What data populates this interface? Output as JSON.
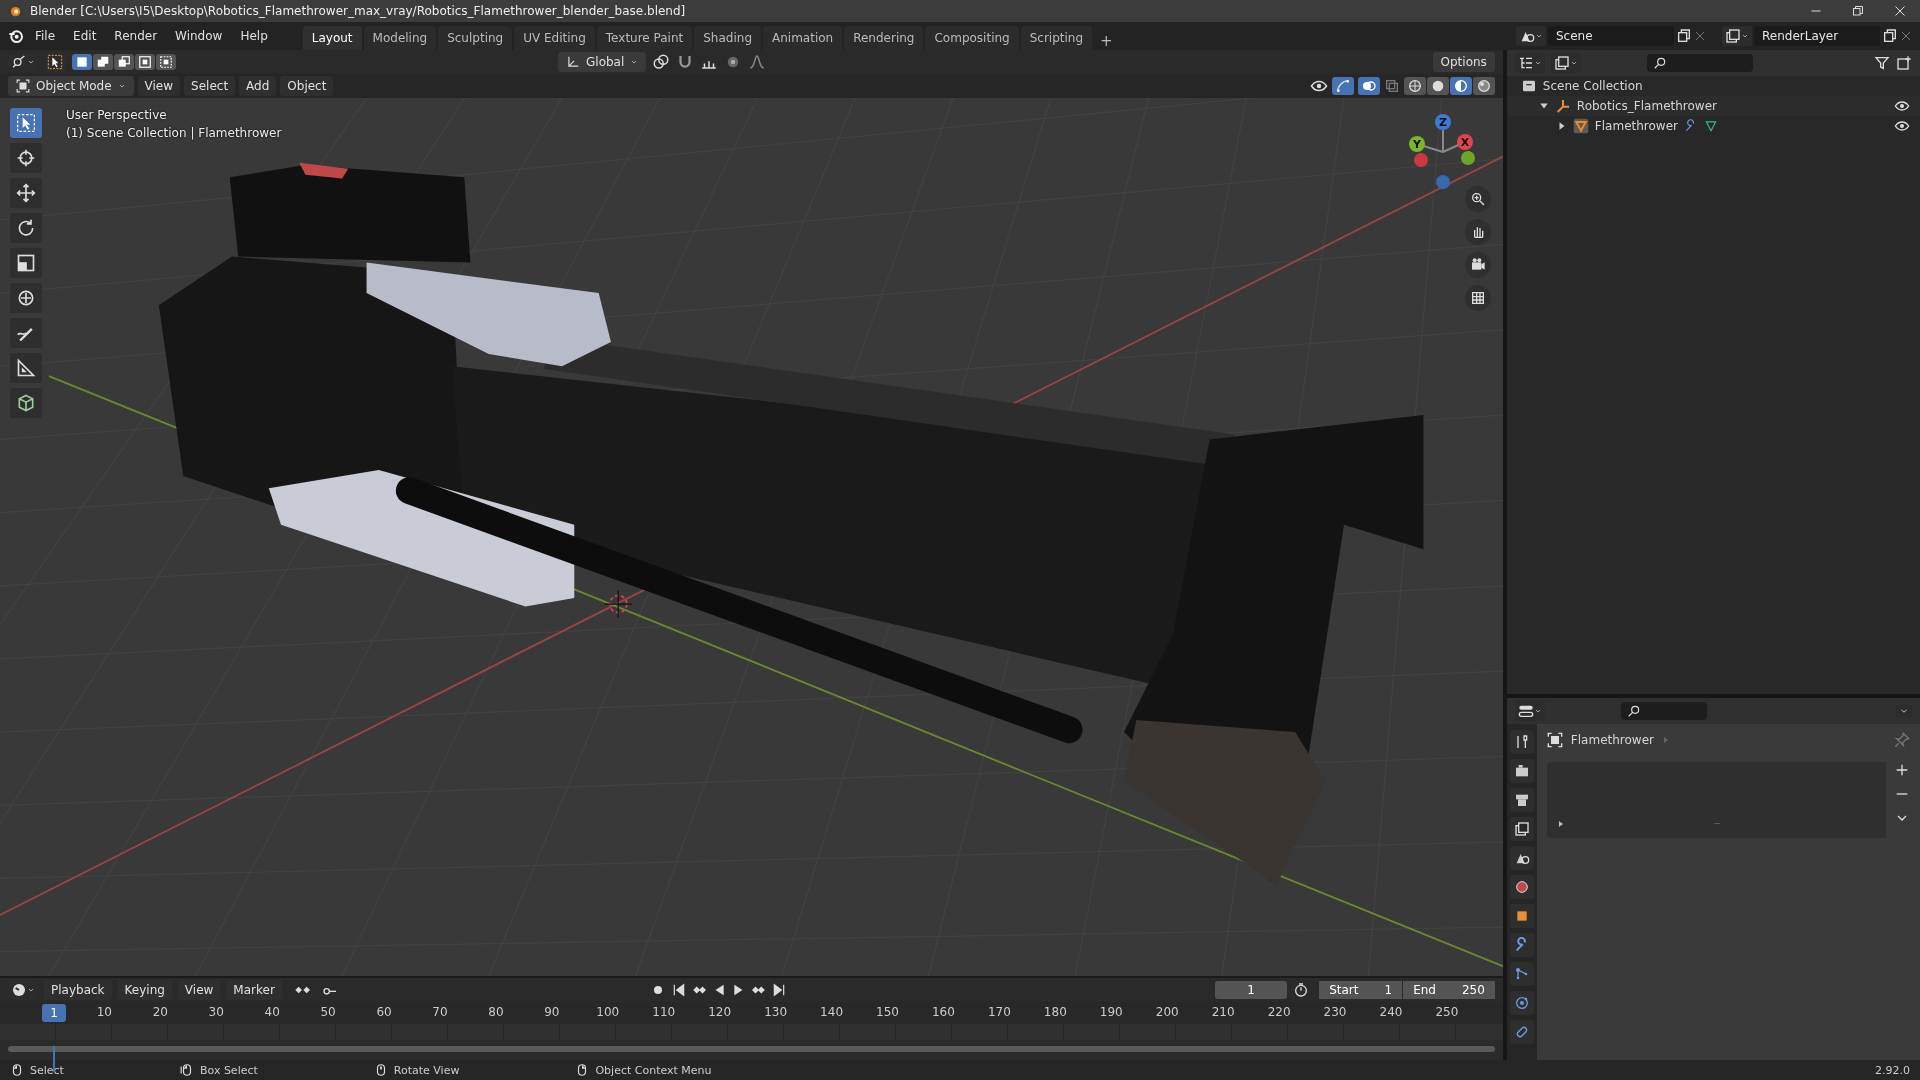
{
  "window": {
    "title": "Blender [C:\\Users\\I5\\Desktop\\Robotics_Flamethrower_max_vray/Robotics_Flamethrower_blender_base.blend]"
  },
  "menus": [
    {
      "label": "File"
    },
    {
      "label": "Edit"
    },
    {
      "label": "Render"
    },
    {
      "label": "Window"
    },
    {
      "label": "Help"
    }
  ],
  "workspaces": [
    {
      "label": "Layout",
      "selected": true
    },
    {
      "label": "Modeling",
      "selected": false
    },
    {
      "label": "Sculpting",
      "selected": false
    },
    {
      "label": "UV Editing",
      "selected": false
    },
    {
      "label": "Texture Paint",
      "selected": false
    },
    {
      "label": "Shading",
      "selected": false
    },
    {
      "label": "Animation",
      "selected": false
    },
    {
      "label": "Rendering",
      "selected": false
    },
    {
      "label": "Compositing",
      "selected": false
    },
    {
      "label": "Scripting",
      "selected": false
    }
  ],
  "add_workspace": "+",
  "scene": {
    "name": "Scene"
  },
  "view_layer": {
    "name": "RenderLayer"
  },
  "tool_header": {
    "selection_modes": [
      {
        "selected": true
      },
      {
        "selected": false
      },
      {
        "selected": false
      },
      {
        "selected": false
      },
      {
        "selected": false
      }
    ],
    "orientation": "Global",
    "options": "Options"
  },
  "viewport_header": {
    "mode": "Object Mode",
    "menus": [
      "View",
      "Select",
      "Add",
      "Object"
    ],
    "shading": [
      {
        "kind": "wireframe",
        "selected": false
      },
      {
        "kind": "solid",
        "selected": false
      },
      {
        "kind": "material",
        "selected": true
      },
      {
        "kind": "rendered",
        "selected": false
      }
    ]
  },
  "viewport": {
    "perspective": "User Perspective",
    "info": "(1) Scene Collection | Flamethrower",
    "axes": [
      {
        "label": "Z"
      },
      {
        "label": "Y"
      },
      {
        "label": "X"
      }
    ]
  },
  "tools": [
    {
      "kind": "select",
      "selected": true
    },
    {
      "kind": "cursor",
      "selected": false
    },
    {
      "kind": "move",
      "selected": false
    },
    {
      "kind": "rotate",
      "selected": false
    },
    {
      "kind": "scale",
      "selected": false
    },
    {
      "kind": "transform",
      "selected": false
    },
    {
      "kind": "annotate",
      "selected": false
    },
    {
      "kind": "measure",
      "selected": false
    },
    {
      "kind": "add_cube",
      "selected": false
    }
  ],
  "outliner": {
    "items": [
      {
        "label": "Scene Collection",
        "kind": "collection",
        "children": [
          {
            "label": "Robotics_Flamethrower",
            "kind": "empty",
            "expanded": true,
            "visible": true,
            "children": [
              {
                "label": "Flamethrower",
                "kind": "mesh",
                "expanded": false,
                "visible": true
              }
            ]
          }
        ]
      }
    ]
  },
  "properties": {
    "tabs": [
      {
        "kind": "tool",
        "selected": false
      },
      {
        "kind": "render",
        "selected": false
      },
      {
        "kind": "output",
        "selected": false
      },
      {
        "kind": "view_layer",
        "selected": false
      },
      {
        "kind": "scene",
        "selected": false
      },
      {
        "kind": "world",
        "selected": false
      },
      {
        "kind": "object",
        "selected": false
      },
      {
        "kind": "modifiers",
        "selected": false
      },
      {
        "kind": "particles",
        "selected": false
      },
      {
        "kind": "physics",
        "selected": false
      },
      {
        "kind": "constraints",
        "selected": false
      }
    ],
    "object": "Flamethrower"
  },
  "timeline": {
    "menus": [
      "Playback",
      "Keying",
      "View",
      "Marker"
    ],
    "current_frame": "1",
    "start_label": "Start",
    "start": "1",
    "end_label": "End",
    "end": "250",
    "playhead": "1",
    "ticks": [
      "10",
      "20",
      "30",
      "40",
      "50",
      "60",
      "70",
      "80",
      "90",
      "100",
      "110",
      "120",
      "130",
      "140",
      "150",
      "160",
      "170",
      "180",
      "190",
      "200",
      "210",
      "220",
      "230",
      "240",
      "250"
    ]
  },
  "status_bar": {
    "hints": [
      {
        "kind": "left_click",
        "label": "Select"
      },
      {
        "kind": "left_drag",
        "label": "Box Select"
      },
      {
        "kind": "middle",
        "label": "Rotate View"
      },
      {
        "kind": "right_click",
        "label": "Object Context Menu"
      }
    ],
    "version": "2.92.0"
  }
}
